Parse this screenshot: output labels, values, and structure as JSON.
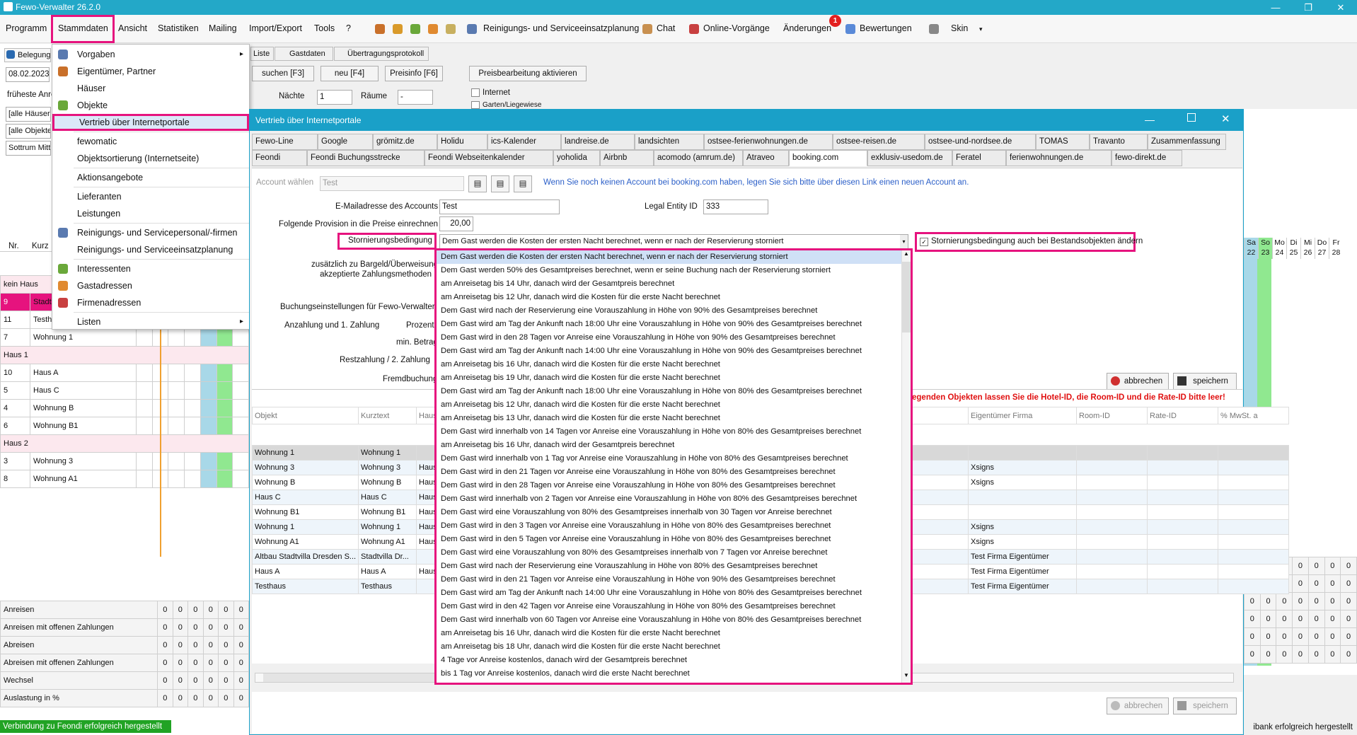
{
  "window": {
    "title": "Fewo-Verwalter 26.2.0",
    "min": "—",
    "restore": "❐",
    "close": "✕"
  },
  "menu": {
    "items": [
      "Programm",
      "Stammdaten",
      "Ansicht",
      "Statistiken",
      "Mailing",
      "Import/Export",
      "Tools",
      "?"
    ],
    "cleaning": "Reinigungs- und Serviceeinsatzplanung",
    "chat": "Chat",
    "online": "Online-Vorgänge",
    "changes": "Änderungen",
    "changes_badge": "1",
    "ratings": "Bewertungen",
    "skin": "Skin"
  },
  "stammdaten_menu": [
    "Vorgaben",
    "Eigentümer, Partner",
    "Häuser",
    "Objekte",
    "Vertrieb über Internetportale",
    "fewomatic",
    "Objektsortierung (Internetseite)",
    "Aktionsangebote",
    "Lieferanten",
    "Leistungen",
    "Reinigungs- und Servicepersonal/-firmen",
    "Reinigungs- und Serviceeinsatzplanung",
    "Interessenten",
    "Gastadressen",
    "Firmenadressen",
    "Listen"
  ],
  "main": {
    "tab_belegung": "Belegung",
    "tab_liste": "Liste",
    "tab_gastdaten": "Gastdaten",
    "tab_protokoll": "Übertragungsprotokoll",
    "date": "08.02.2023",
    "search_btn": "suchen [F3]",
    "new_btn": "neu [F4]",
    "price_btn": "Preisinfo [F6]",
    "price_edit_btn": "Preisbearbeitung aktivieren",
    "earliest_label": "früheste Anrei",
    "all_houses": "[alle Häuser]",
    "all_objects": "[alle Objekte]",
    "sort": "Sottrum Mitte",
    "nights_label": "Nächte",
    "nights_value": "1",
    "rooms_label": "Räume",
    "rooms_value": "-",
    "internet_label": "Internet",
    "garden_label": "Garten/Liegewiese",
    "col_nr": "Nr.",
    "col_kurz": "Kurz"
  },
  "grid_rows": [
    {
      "nr": "kein Haus",
      "kurz": "",
      "group": true
    },
    {
      "nr": "9",
      "kurz": "Stadt",
      "pink": true
    },
    {
      "nr": "11",
      "kurz": "Testh"
    },
    {
      "nr": "7",
      "kurz": "Wohnung 1"
    },
    {
      "nr": "Haus 1",
      "kurz": "",
      "group": true
    },
    {
      "nr": "10",
      "kurz": "Haus A"
    },
    {
      "nr": "5",
      "kurz": "Haus C"
    },
    {
      "nr": "4",
      "kurz": "Wohnung B"
    },
    {
      "nr": "6",
      "kurz": "Wohnung B1"
    },
    {
      "nr": "Haus 2",
      "kurz": "",
      "group": true
    },
    {
      "nr": "3",
      "kurz": "Wohnung 3"
    },
    {
      "nr": "8",
      "kurz": "Wohnung A1"
    }
  ],
  "stats": [
    "Anreisen",
    "Anreisen mit offenen Zahlungen",
    "Abreisen",
    "Abreisen mit offenen Zahlungen",
    "Wechsel",
    "Auslastung in %"
  ],
  "zero": "0",
  "status_left": "Verbindung zu Feondi erfolgreich hergestellt",
  "status_right": "ibank erfolgreich hergestellt",
  "cal_days": [
    {
      "d": "Sa",
      "n": "22"
    },
    {
      "d": "So",
      "n": "23"
    },
    {
      "d": "Mo",
      "n": "24"
    },
    {
      "d": "Di",
      "n": "25"
    },
    {
      "d": "Mi",
      "n": "26"
    },
    {
      "d": "Do",
      "n": "27"
    },
    {
      "d": "Fr",
      "n": "28"
    }
  ],
  "dialog": {
    "title": "Vertrieb über Internetportale",
    "tabs_row1": [
      "Fewo-Line",
      "Google",
      "grömitz.de",
      "Holidu",
      "ics-Kalender",
      "landreise.de",
      "landsichten",
      "ostsee-ferienwohnungen.de",
      "ostsee-reisen.de",
      "ostsee-und-nordsee.de",
      "TOMAS",
      "Travanto",
      "Zusammenfassung"
    ],
    "tabs_row2": [
      "Feondi",
      "Feondi Buchungsstrecke",
      "Feondi Webseitenkalender",
      "yoholida",
      "Airbnb",
      "acomodo (amrum.de)",
      "Atraveo",
      "booking.com",
      "exklusiv-usedom.de",
      "Feratel",
      "ferienwohnungen.de",
      "fewo-direkt.de"
    ],
    "account_label": "Account wählen",
    "account_value": "Test",
    "account_hint": "Wenn Sie noch keinen Account bei booking.com haben, legen Sie sich bitte über diesen Link einen neuen Account an.",
    "email_label": "E-Mailadresse des Accounts",
    "email_value": "Test",
    "legal_label": "Legal Entity ID",
    "legal_value": "333",
    "provision_label": "Folgende Provision in die Preise einrechnen",
    "provision_value": "20,00",
    "storno_label": "Stornierungsbedingung",
    "storno_value": "Dem Gast werden die Kosten der ersten Nacht berechnet, wenn er nach der Reservierung storniert",
    "storno_check": "Stornierungsbedingung auch bei Bestandsobjekten ändern",
    "payments_label1": "zusätzlich zu Bargeld/Überweisung",
    "payments_label2": "akzeptierte Zahlungsmethoden",
    "booking_label": "Buchungseinstellungen für Fewo-Verwalter. D",
    "deposit_label": "Anzahlung und 1. Zahlung",
    "percent_label": "Prozent",
    "min_label": "min. Betrag",
    "rest_label": "Restzahlung / 2. Zahlung",
    "foreign_label": "Fremdbuchung",
    "cancel_btn": "abbrechen",
    "save_btn": "speichern",
    "warning": "egenden Objekten lassen Sie die Hotel-ID, die Room-ID und die Rate-ID bitte leer!",
    "table_headers": [
      "Objekt",
      "Kurztext",
      "Haus",
      "Eigentümer Firma",
      "Room-ID",
      "Rate-ID",
      "% MwSt. a"
    ],
    "table_rows": [
      {
        "obj": "Wohnung 1",
        "kurz": "Wohnung 1",
        "haus": "",
        "firma": ""
      },
      {
        "obj": "Wohnung 3",
        "kurz": "Wohnung 3",
        "haus": "Haus",
        "firma": "Xsigns"
      },
      {
        "obj": "Wohnung B",
        "kurz": "Wohnung B",
        "haus": "Haus",
        "firma": "Xsigns"
      },
      {
        "obj": "Haus C",
        "kurz": "Haus C",
        "haus": "Haus",
        "firma": ""
      },
      {
        "obj": "Wohnung B1",
        "kurz": "Wohnung B1",
        "haus": "Haus",
        "firma": ""
      },
      {
        "obj": "Wohnung 1",
        "kurz": "Wohnung 1",
        "haus": "Haus",
        "firma": "Xsigns"
      },
      {
        "obj": "Wohnung A1",
        "kurz": "Wohnung A1",
        "haus": "Haus",
        "firma": "Xsigns"
      },
      {
        "obj": "Altbau Stadtvilla Dresden S...",
        "kurz": "Stadtvilla Dr...",
        "haus": "",
        "firma": "Test Firma Eigentümer"
      },
      {
        "obj": "Haus A",
        "kurz": "Haus A",
        "haus": "Haus",
        "firma": "Test Firma Eigentümer"
      },
      {
        "obj": "Testhaus",
        "kurz": "Testhaus",
        "haus": "",
        "firma": "Test Firma Eigentümer"
      }
    ],
    "bottom_cancel": "abbrechen",
    "bottom_save": "speichern"
  },
  "storno_options": [
    "Dem Gast werden die Kosten der ersten Nacht berechnet, wenn er nach der Reservierung storniert",
    "Dem Gast werden 50% des Gesamtpreises berechnet, wenn er seine Buchung nach der Reservierung storniert",
    "am Anreisetag bis 14 Uhr, danach wird der Gesamtpreis berechnet",
    "am Anreisetag bis 12 Uhr, danach wird die  Kosten für die erste Nacht berechnet",
    "Dem Gast wird nach der Reservierung eine Vorauszahlung in Höhe von 90% des Gesamtpreises berechnet",
    "Dem Gast wird am Tag der Ankunft nach 18:00 Uhr eine Vorauszahlung in Höhe von 90% des Gesamtpreises berechnet",
    "Dem Gast wird in den 28 Tagen vor Anreise eine Vorauszahlung in Höhe von 90% des Gesamtpreises berechnet",
    "Dem Gast wird am Tag der Ankunft nach 14:00 Uhr eine Vorauszahlung in Höhe von 90% des Gesamtpreises berechnet",
    "am Anreisetag bis 16 Uhr, danach wird die  Kosten für die erste Nacht berechnet",
    "am Anreisetag bis 19 Uhr, danach wird die  Kosten für die erste Nacht berechnet",
    "Dem Gast wird am Tag der Ankunft nach 18:00 Uhr eine Vorauszahlung in Höhe von 80% des Gesamtpreises berechnet",
    "am Anreisetag bis 12 Uhr, danach wird die  Kosten für die erste Nacht berechnet",
    "am Anreisetag bis 13 Uhr, danach wird die  Kosten für die erste Nacht berechnet",
    "Dem Gast wird innerhalb von 14 Tagen vor Anreise eine Vorauszahlung in Höhe von 80% des Gesamtpreises berechnet",
    "am Anreisetag bis 16 Uhr, danach wird der Gesamtpreis berechnet",
    "Dem Gast wird innerhalb von 1 Tag vor Anreise eine Vorauszahlung in Höhe von 80% des Gesamtpreises berechnet",
    "Dem Gast wird in den 21 Tagen vor Anreise eine Vorauszahlung in Höhe von 80% des Gesamtpreises berechnet",
    "Dem Gast wird in den 28 Tagen vor Anreise eine Vorauszahlung in Höhe von 80% des Gesamtpreises berechnet",
    "Dem Gast wird innerhalb von 2 Tagen vor Anreise eine Vorauszahlung in Höhe von 80% des Gesamtpreises berechnet",
    "Dem Gast wird eine Vorauszahlung von 80% des Gesamtpreises innerhalb von 30 Tagen vor Anreise berechnet",
    "Dem Gast wird in den 3 Tagen vor Anreise eine Vorauszahlung in Höhe von 80% des Gesamtpreises berechnet",
    "Dem Gast wird in den 5 Tagen vor Anreise eine Vorauszahlung in Höhe von 80% des Gesamtpreises berechnet",
    "Dem Gast wird eine Vorauszahlung von 80% des Gesamtpreises innerhalb von 7 Tagen vor Anreise berechnet",
    "Dem Gast wird nach der Reservierung eine Vorauszahlung in Höhe von 80% des Gesamtpreises berechnet",
    "Dem Gast wird in den 21 Tagen vor Anreise eine Vorauszahlung in Höhe von 90% des Gesamtpreises berechnet",
    "Dem Gast wird am Tag der Ankunft nach 14:00 Uhr eine Vorauszahlung in Höhe von 80% des Gesamtpreises berechnet",
    "Dem Gast wird in den 42 Tagen vor Anreise eine Vorauszahlung in Höhe von 80% des Gesamtpreises berechnet",
    "Dem Gast wird innerhalb von 60 Tagen vor Anreise eine Vorauszahlung in Höhe von 80% des Gesamtpreises berechnet",
    "am Anreisetag bis 16 Uhr, danach wird die  Kosten für die erste Nacht berechnet",
    "am Anreisetag bis 18 Uhr, danach wird die  Kosten für die erste Nacht berechnet",
    "4 Tage vor Anreise kostenlos, danach wird der Gesamtpreis berechnet",
    "bis 1 Tag vor Anreise kostenlos, danach wird die erste Nacht berechnet"
  ],
  "colors": {
    "accent": "#1aa0c8",
    "highlight": "#e6137e",
    "group_row": "#fce8ee",
    "green_col": "#90e890",
    "blue_col": "#a8d8e8"
  }
}
